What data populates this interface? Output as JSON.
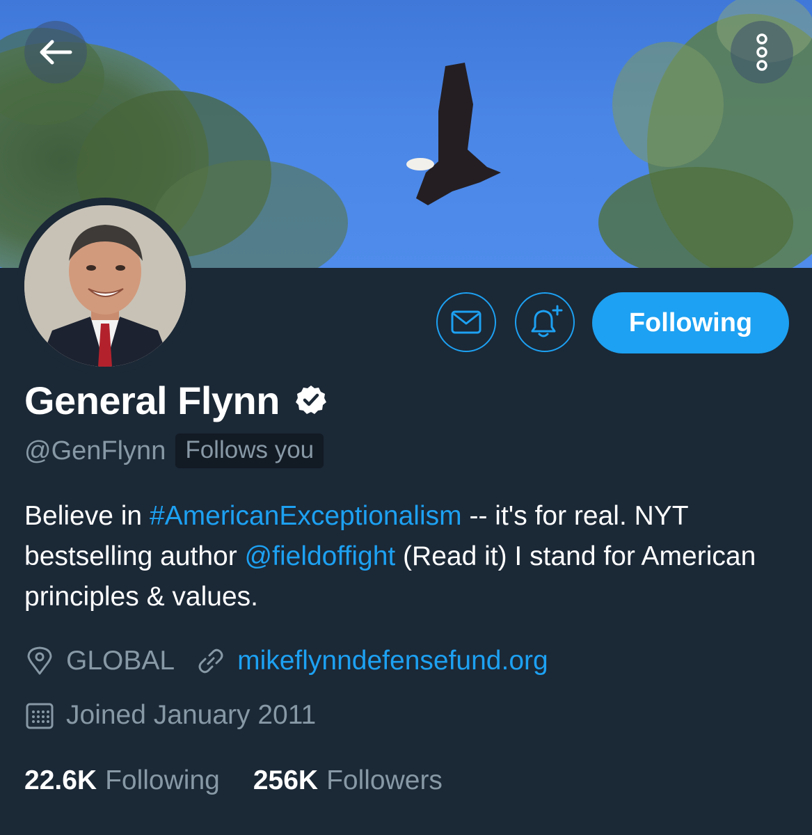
{
  "profile": {
    "name": "General Flynn",
    "handle": "@GenFlynn",
    "follows_badge": "Follows you",
    "verified": true
  },
  "actions": {
    "following_label": "Following"
  },
  "bio": {
    "part1": "Believe in ",
    "hashtag": "#AmericanExceptionalism",
    "part2": " -- it's for real. NYT bestselling author ",
    "mention": "@fieldoffight",
    "part3": " (Read it) I stand for American principles & values."
  },
  "meta": {
    "location": "GLOBAL",
    "website": "mikeflynndefensefund.org",
    "joined": "Joined January 2011"
  },
  "stats": {
    "following_count": "22.6K",
    "following_label": "Following",
    "followers_count": "256K",
    "followers_label": "Followers"
  },
  "colors": {
    "background": "#1b2836",
    "accent": "#1da1f2",
    "muted": "#8899a6"
  },
  "icons": [
    "back-arrow-icon",
    "more-vertical-icon",
    "envelope-icon",
    "bell-plus-icon",
    "verified-icon",
    "location-pin-icon",
    "link-icon",
    "calendar-icon"
  ]
}
